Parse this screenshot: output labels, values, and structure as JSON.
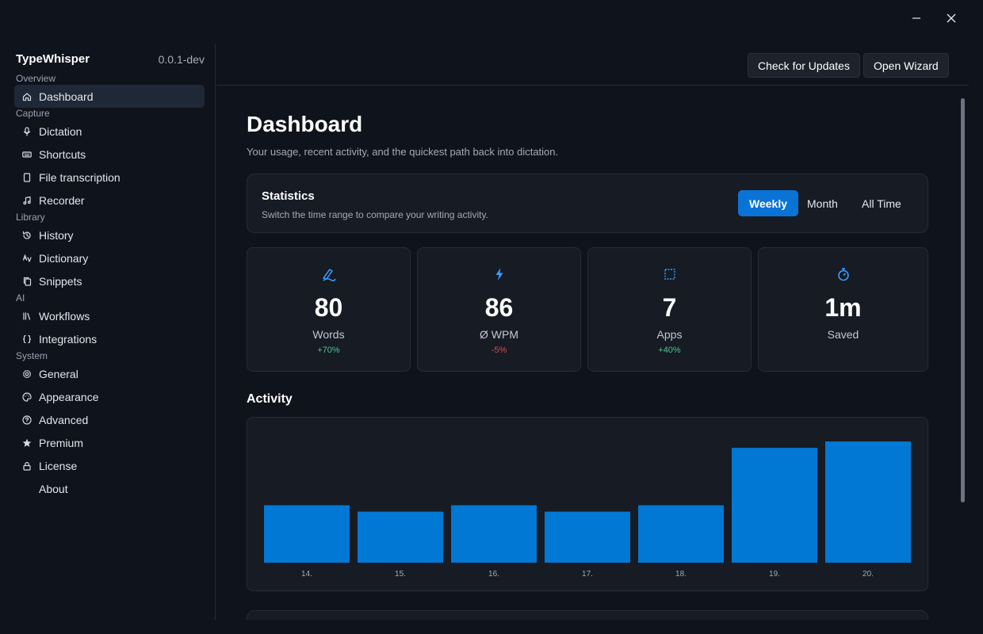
{
  "window": {
    "minimize_icon": "minimize-icon",
    "close_icon": "close-icon"
  },
  "app": {
    "name": "TypeWhisper",
    "version": "0.0.1-dev"
  },
  "sidebar": {
    "sections": [
      {
        "label": "Overview",
        "items": [
          {
            "label": "Dashboard",
            "icon": "home-icon",
            "active": true
          }
        ]
      },
      {
        "label": "Capture",
        "items": [
          {
            "label": "Dictation",
            "icon": "microphone-icon"
          },
          {
            "label": "Shortcuts",
            "icon": "keyboard-icon"
          },
          {
            "label": "File transcription",
            "icon": "file-icon"
          },
          {
            "label": "Recorder",
            "icon": "music-note-icon"
          }
        ]
      },
      {
        "label": "Library",
        "items": [
          {
            "label": "History",
            "icon": "history-icon"
          },
          {
            "label": "Dictionary",
            "icon": "dictionary-icon"
          },
          {
            "label": "Snippets",
            "icon": "copy-icon"
          }
        ]
      },
      {
        "label": "AI",
        "items": [
          {
            "label": "Workflows",
            "icon": "library-icon"
          },
          {
            "label": "Integrations",
            "icon": "braces-icon"
          }
        ]
      },
      {
        "label": "System",
        "items": [
          {
            "label": "General",
            "icon": "gear-icon"
          },
          {
            "label": "Appearance",
            "icon": "palette-icon"
          },
          {
            "label": "Advanced",
            "icon": "help-circle-icon"
          },
          {
            "label": "Premium",
            "icon": "star-icon"
          },
          {
            "label": "License",
            "icon": "lock-icon"
          },
          {
            "label": "About",
            "icon": "info-icon"
          }
        ]
      }
    ]
  },
  "header": {
    "check_updates_label": "Check for Updates",
    "open_wizard_label": "Open Wizard"
  },
  "dashboard": {
    "title": "Dashboard",
    "subtitle": "Your usage, recent activity, and the quickest path back into dictation.",
    "statistics": {
      "title": "Statistics",
      "subtitle": "Switch the time range to compare your writing activity.",
      "ranges": [
        {
          "label": "Weekly",
          "active": true
        },
        {
          "label": "Month",
          "active": false
        },
        {
          "label": "All Time",
          "active": false
        }
      ]
    },
    "cards": [
      {
        "icon": "handwriting-icon",
        "value": "80",
        "label": "Words",
        "delta": "+70%",
        "trend": "up"
      },
      {
        "icon": "lightning-icon",
        "value": "86",
        "label": "Ø WPM",
        "delta": "-5%",
        "trend": "down"
      },
      {
        "icon": "app-window-icon",
        "value": "7",
        "label": "Apps",
        "delta": "+40%",
        "trend": "up"
      },
      {
        "icon": "stopwatch-icon",
        "value": "1m",
        "label": "Saved",
        "delta": "",
        "trend": "none"
      }
    ],
    "activity_title": "Activity"
  },
  "colors": {
    "accent": "#0a73d6",
    "bar": "#0078d4",
    "positive": "#4cc38a",
    "negative": "#e5484d"
  },
  "chart_data": {
    "type": "bar",
    "categories": [
      "14.",
      "15.",
      "16.",
      "17.",
      "18.",
      "19.",
      "20."
    ],
    "values": [
      9,
      8,
      9,
      8,
      9,
      18,
      19
    ],
    "ylim": [
      0,
      20
    ],
    "grid": false,
    "legend": "none"
  }
}
